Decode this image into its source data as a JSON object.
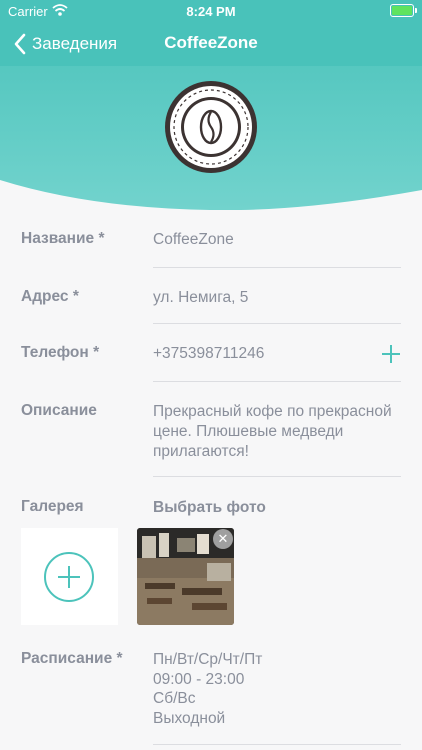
{
  "status": {
    "carrier": "Carrier",
    "time": "8:24 PM"
  },
  "nav": {
    "back_label": "Заведения",
    "title": "CoffeeZone"
  },
  "colors": {
    "accent": "#4cc3bb",
    "header_top": "#49c2ba",
    "header_bottom": "#6fd1cb"
  },
  "fields": {
    "name": {
      "label": "Название *",
      "value": "CoffeeZone"
    },
    "address": {
      "label": "Адрес *",
      "value": "ул. Немига, 5"
    },
    "phone": {
      "label": "Телефон *",
      "value": "+375398711246"
    },
    "description": {
      "label": "Описание",
      "value": "Прекрасный кофе по прекрасной цене. Плюшевые медведи прилагаются!"
    },
    "gallery": {
      "label": "Галерея",
      "action": "Выбрать фото"
    },
    "schedule": {
      "label": "Расписание *",
      "lines": [
        "Пн/Вт/Ср/Чт/Пт",
        "09:00 - 23:00",
        "Сб/Вс",
        "Выходной"
      ]
    }
  },
  "icons": {
    "back": "chevron-left-icon",
    "add": "plus-icon",
    "remove": "close-icon",
    "logo": "coffee-bean-icon"
  }
}
